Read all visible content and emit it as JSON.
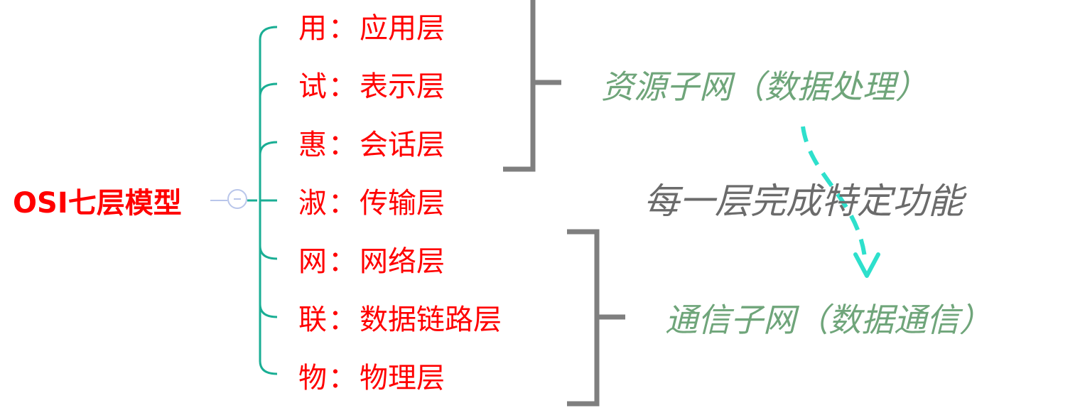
{
  "root": {
    "label": "OSI七层模型",
    "color": "#ff0000"
  },
  "layers": [
    {
      "mnemonic": "用",
      "sep": "：",
      "name": "应用层"
    },
    {
      "mnemonic": "试",
      "sep": "：",
      "name": "表示层"
    },
    {
      "mnemonic": "惠",
      "sep": "：",
      "name": "会话层"
    },
    {
      "mnemonic": "淑",
      "sep": "：",
      "name": "传输层"
    },
    {
      "mnemonic": "网",
      "sep": "：",
      "name": "网络层"
    },
    {
      "mnemonic": "联",
      "sep": "：",
      "name": "数据链路层"
    },
    {
      "mnemonic": "物",
      "sep": "：",
      "name": "物理层"
    }
  ],
  "groups": {
    "resource": {
      "label": "资源子网（数据处理）"
    },
    "communication": {
      "label": "通信子网（数据通信）"
    }
  },
  "center_note": "每一层完成特定功能",
  "colors": {
    "layer_text": "#ff0000",
    "branch_line": "#1aae94",
    "bracket": "#7f7f7f",
    "group_text": "#6fa57a",
    "center_text": "#6b6b6b",
    "arrow": "#2ee0cc",
    "toggle": "#b9c6ea"
  },
  "icons": {
    "toggle": "collapse-minus-icon",
    "arrow": "arrow-down-icon"
  }
}
